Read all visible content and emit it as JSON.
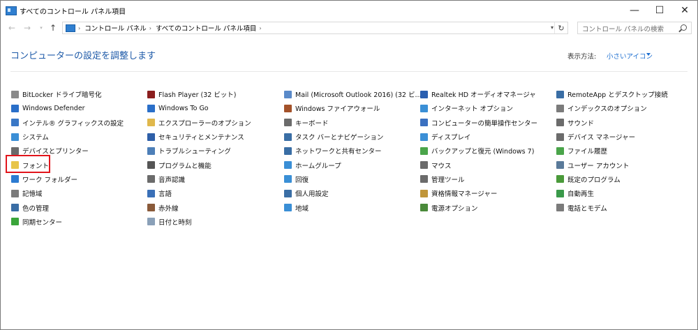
{
  "window": {
    "title": "すべてのコントロール パネル項目",
    "minimize": "—",
    "maximize": "☐",
    "close": "✕"
  },
  "address": {
    "crumbs": [
      "コントロール パネル",
      "すべてのコントロール パネル項目"
    ]
  },
  "search": {
    "placeholder": "コントロール パネルの検索"
  },
  "heading": "コンピューターの設定を調整します",
  "view_by": {
    "label": "表示方法:",
    "value": "小さいアイコン"
  },
  "highlight_item": "フォント",
  "columns": [
    {
      "items": [
        {
          "label": "BitLocker ドライブ暗号化",
          "icon": "bitlocker-icon",
          "color": "#8a8a8a"
        },
        {
          "label": "Windows Defender",
          "icon": "defender-icon",
          "color": "#2a6fc9"
        },
        {
          "label": "インテル® グラフィックスの設定",
          "icon": "intel-graphics-icon",
          "color": "#3a78c6"
        },
        {
          "label": "システム",
          "icon": "system-icon",
          "color": "#3b8fd6"
        },
        {
          "label": "デバイスとプリンター",
          "icon": "printer-icon",
          "color": "#6b6b6b"
        },
        {
          "label": "フォント",
          "icon": "font-icon",
          "color": "#e8c54a"
        },
        {
          "label": "ワーク フォルダー",
          "icon": "work-folders-icon",
          "color": "#2c7bd1"
        },
        {
          "label": "記憶域",
          "icon": "storage-icon",
          "color": "#7b7b7b"
        },
        {
          "label": "色の管理",
          "icon": "color-management-icon",
          "color": "#3a6ea5"
        },
        {
          "label": "同期センター",
          "icon": "sync-center-icon",
          "color": "#3aa53a"
        }
      ]
    },
    {
      "items": [
        {
          "label": "Flash Player (32 ビット)",
          "icon": "flash-icon",
          "color": "#8b1e1e"
        },
        {
          "label": "Windows To Go",
          "icon": "windows-to-go-icon",
          "color": "#2a6fc9"
        },
        {
          "label": "エクスプローラーのオプション",
          "icon": "folder-options-icon",
          "color": "#e0b84c"
        },
        {
          "label": "セキュリティとメンテナンス",
          "icon": "security-flag-icon",
          "color": "#2e5fa8"
        },
        {
          "label": "トラブルシューティング",
          "icon": "troubleshooting-icon",
          "color": "#4d7fb8"
        },
        {
          "label": "プログラムと機能",
          "icon": "programs-icon",
          "color": "#555555"
        },
        {
          "label": "音声認識",
          "icon": "microphone-icon",
          "color": "#6b6b6b"
        },
        {
          "label": "言語",
          "icon": "language-icon",
          "color": "#3a70b8"
        },
        {
          "label": "赤外線",
          "icon": "infrared-icon",
          "color": "#8a5a3a"
        },
        {
          "label": "日付と時刻",
          "icon": "date-time-icon",
          "color": "#8aa0b8"
        }
      ]
    },
    {
      "items": [
        {
          "label": "Mail (Microsoft Outlook 2016) (32 ビ...",
          "icon": "mail-icon",
          "color": "#5a8ac9"
        },
        {
          "label": "Windows ファイアウォール",
          "icon": "firewall-icon",
          "color": "#a3522a"
        },
        {
          "label": "キーボード",
          "icon": "keyboard-icon",
          "color": "#6b6b6b"
        },
        {
          "label": "タスク バーとナビゲーション",
          "icon": "taskbar-icon",
          "color": "#3a6ea5"
        },
        {
          "label": "ネットワークと共有センター",
          "icon": "network-icon",
          "color": "#3a6ea5"
        },
        {
          "label": "ホームグループ",
          "icon": "homegroup-icon",
          "color": "#3a8fd6"
        },
        {
          "label": "回復",
          "icon": "recovery-icon",
          "color": "#3a8fd6"
        },
        {
          "label": "個人用設定",
          "icon": "personalization-icon",
          "color": "#3a6ea5"
        },
        {
          "label": "地域",
          "icon": "region-icon",
          "color": "#3a8fd6"
        }
      ]
    },
    {
      "items": [
        {
          "label": "Realtek HD オーディオマネージャ",
          "icon": "realtek-icon",
          "color": "#2a5fb0"
        },
        {
          "label": "インターネット オプション",
          "icon": "internet-options-icon",
          "color": "#3a8fd6"
        },
        {
          "label": "コンピューターの簡単操作センター",
          "icon": "ease-of-access-icon",
          "color": "#3a70c0"
        },
        {
          "label": "ディスプレイ",
          "icon": "display-icon",
          "color": "#3b8fd6"
        },
        {
          "label": "バックアップと復元 (Windows 7)",
          "icon": "backup-icon",
          "color": "#4aa54a"
        },
        {
          "label": "マウス",
          "icon": "mouse-icon",
          "color": "#6b6b6b"
        },
        {
          "label": "管理ツール",
          "icon": "admin-tools-icon",
          "color": "#6b6b6b"
        },
        {
          "label": "資格情報マネージャー",
          "icon": "credential-icon",
          "color": "#c0963a"
        },
        {
          "label": "電源オプション",
          "icon": "power-icon",
          "color": "#4a8a3a"
        }
      ]
    },
    {
      "items": [
        {
          "label": "RemoteApp とデスクトップ接続",
          "icon": "remoteapp-icon",
          "color": "#3a6ea5"
        },
        {
          "label": "インデックスのオプション",
          "icon": "indexing-icon",
          "color": "#7b7b7b"
        },
        {
          "label": "サウンド",
          "icon": "sound-icon",
          "color": "#6b6b6b"
        },
        {
          "label": "デバイス マネージャー",
          "icon": "device-manager-icon",
          "color": "#6b6b6b"
        },
        {
          "label": "ファイル履歴",
          "icon": "file-history-icon",
          "color": "#4aa54a"
        },
        {
          "label": "ユーザー アカウント",
          "icon": "user-accounts-icon",
          "color": "#5a7a9a"
        },
        {
          "label": "既定のプログラム",
          "icon": "default-programs-icon",
          "color": "#4a9a3a"
        },
        {
          "label": "自動再生",
          "icon": "autoplay-icon",
          "color": "#3a9a4a"
        },
        {
          "label": "電話とモデム",
          "icon": "phone-modem-icon",
          "color": "#7b7b7b"
        }
      ]
    }
  ]
}
